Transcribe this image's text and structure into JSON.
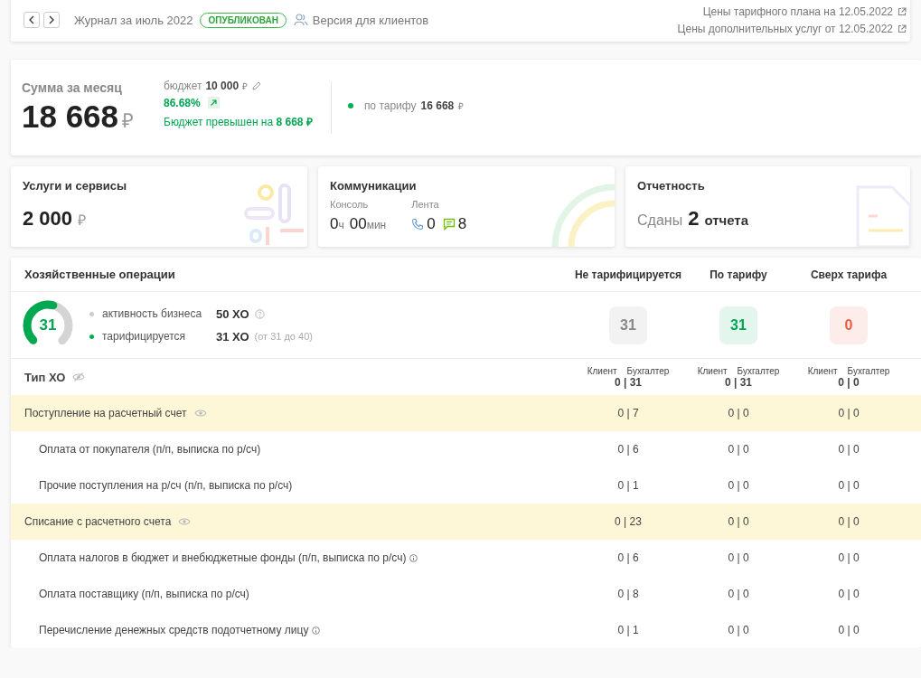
{
  "topbar": {
    "journal_title": "Журнал за июль 2022",
    "status_badge": "ОПУБЛИКОВАН",
    "clients_link": "Версия для клиентов",
    "price_links": [
      "Цены тарифного плана на 12.05.2022",
      "Цены дополнительных услуг от 12.05.2022"
    ]
  },
  "summary": {
    "label": "Сумма за месяц",
    "amount": "18 668",
    "currency": "₽",
    "budget_label": "бюджет",
    "budget_value": "10 000",
    "budget_currency": "₽",
    "percent": "86.68%",
    "overrun": "Бюджет превышен на **8 668 ₽**",
    "tariff_label": "по тарифу",
    "tariff_value": "16 668",
    "tariff_currency": "₽"
  },
  "services": {
    "title": "Услуги и сервисы",
    "amount": "2 000",
    "currency": "₽"
  },
  "communications": {
    "title": "Коммуникации",
    "console_label": "Консоль",
    "hours": "0",
    "hours_unit": "ч",
    "minutes": "00",
    "minutes_unit": "мин",
    "feed_label": "Лента",
    "calls": "0",
    "messages": "8"
  },
  "reports": {
    "title": "Отчетность",
    "prefix": "Сданы",
    "count": "2",
    "unit": "отчета"
  },
  "operations": {
    "title": "Хозяйственные операции",
    "columns": [
      {
        "label": "Не тарифицируется",
        "count": "31",
        "color": "#888888"
      },
      {
        "label": "По тарифу",
        "count": "31",
        "color": "#00a651"
      },
      {
        "label": "Сверх тарифа",
        "count": "0",
        "color": "#f05a40"
      }
    ],
    "gauge": {
      "value": "31",
      "level": 0.55
    },
    "stats": [
      {
        "label": "активность бизнеса",
        "value": "50 ХО",
        "help": true,
        "color": "#cccccc"
      },
      {
        "label": "тарифицируется",
        "value": "31 ХО",
        "note": "(от 31 до 40)",
        "help": false,
        "color": "#00b050"
      }
    ],
    "type_header": "Тип ХО",
    "subheaders": [
      {
        "client": "Клиент",
        "accountant": "Бухгалтер",
        "value": "0 | 31"
      },
      {
        "client": "Клиент",
        "accountant": "Бухгалтер",
        "value": "0 | 31"
      },
      {
        "client": "Клиент",
        "accountant": "Бухгалтер",
        "value": "0 | 0"
      }
    ],
    "rows": [
      {
        "kind": "group",
        "label": "Поступление на расчетный счет",
        "info": false,
        "values": [
          "0 | 7",
          "0 | 0",
          "0 | 0"
        ]
      },
      {
        "kind": "item",
        "label": "Оплата от покупателя (п/п, выписка по р/сч)",
        "info": false,
        "values": [
          "0 | 6",
          "0 | 0",
          "0 | 0"
        ]
      },
      {
        "kind": "item",
        "label": "Прочие поступления на р/сч (п/п, выписка по р/сч)",
        "info": false,
        "values": [
          "0 | 1",
          "0 | 0",
          "0 | 0"
        ]
      },
      {
        "kind": "group",
        "label": "Списание с расчетного счета",
        "info": false,
        "values": [
          "0 | 23",
          "0 | 0",
          "0 | 0"
        ]
      },
      {
        "kind": "item",
        "label": "Оплата налогов в бюджет и внебюджетные фонды (п/п, выписка по р/сч)",
        "info": true,
        "values": [
          "0 | 6",
          "0 | 0",
          "0 | 0"
        ]
      },
      {
        "kind": "item",
        "label": "Оплата поставщику (п/п, выписка по р/сч)",
        "info": false,
        "values": [
          "0 | 8",
          "0 | 0",
          "0 | 0"
        ]
      },
      {
        "kind": "item",
        "label": "Перечисление денежных средств подотчетному лицу",
        "info": true,
        "values": [
          "0 | 1",
          "0 | 0",
          "0 | 0"
        ]
      }
    ]
  }
}
